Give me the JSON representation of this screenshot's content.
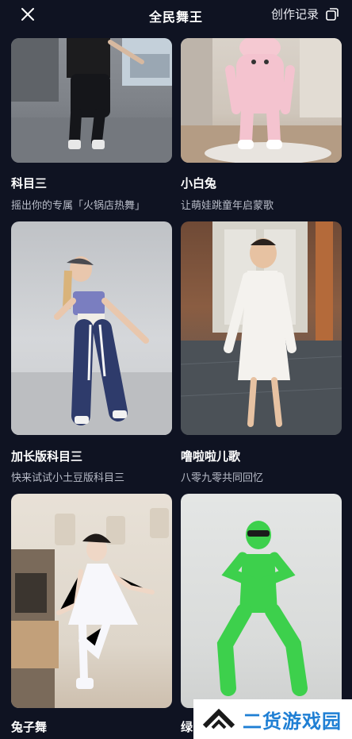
{
  "header": {
    "title": "全民舞王",
    "records_label": "创作记录"
  },
  "cards": [
    {
      "title": "科目三",
      "subtitle": "摇出你的专属「火锅店热舞」"
    },
    {
      "title": "小白兔",
      "subtitle": "让萌娃跳童年启蒙歌"
    },
    {
      "title": "加长版科目三",
      "subtitle": "快来试试小土豆版科目三"
    },
    {
      "title": "噜啦啦儿歌",
      "subtitle": "八零九零共同回忆"
    },
    {
      "title": "兔子舞",
      "subtitle": ""
    },
    {
      "title": "绿",
      "subtitle": ""
    }
  ],
  "watermark": {
    "text": "二货游戏园"
  }
}
